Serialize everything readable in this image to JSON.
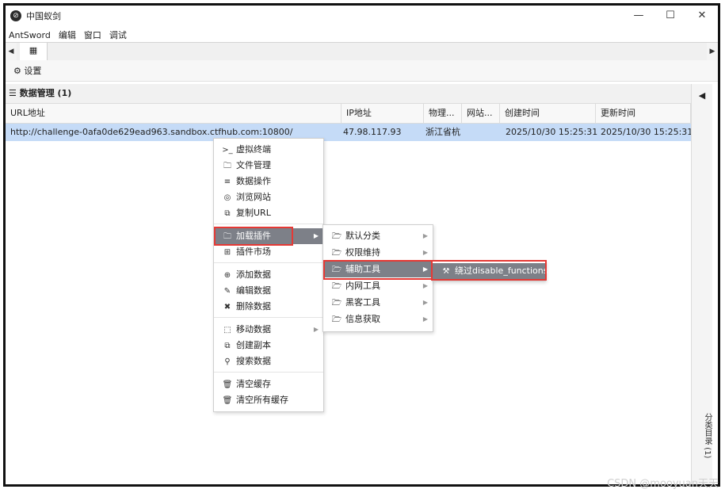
{
  "window": {
    "title": "中国蚁剑",
    "controls": [
      "—",
      "☐",
      "✕"
    ]
  },
  "menubar": [
    "AntSword",
    "编辑",
    "窗口",
    "调试"
  ],
  "toolbar": {
    "settings_label": "设置"
  },
  "panel": {
    "header": "数据管理 (1)"
  },
  "grid": {
    "columns": [
      "URL地址",
      "IP地址",
      "物理...",
      "网站...",
      "创建时间",
      "更新时间"
    ],
    "rows": [
      [
        "http://challenge-0afa0de629ead963.sandbox.ctfhub.com:10800/",
        "47.98.117.93",
        "浙江省杭",
        "",
        "2025/10/30 15:25:31",
        "2025/10/30 15:25:31"
      ]
    ]
  },
  "rail": {
    "label": "分类目录 (1)"
  },
  "context_menu": {
    "items": [
      {
        "icon": "terminal-icon",
        "glyph": ">_",
        "label": "虚拟终端"
      },
      {
        "icon": "folder-icon",
        "glyph": "🗀",
        "label": "文件管理"
      },
      {
        "icon": "database-icon",
        "glyph": "≡",
        "label": "数据操作"
      },
      {
        "icon": "chrome-icon",
        "glyph": "◎",
        "label": "浏览网站"
      },
      {
        "icon": "copy-icon",
        "glyph": "⧉",
        "label": "复制URL"
      },
      {
        "icon": "folder-icon",
        "glyph": "🗀",
        "label": "加载插件"
      },
      {
        "icon": "cart-icon",
        "glyph": "⊞",
        "label": "插件市场"
      },
      {
        "icon": "plus-circle-icon",
        "glyph": "⊕",
        "label": "添加数据"
      },
      {
        "icon": "edit-icon",
        "glyph": "✎",
        "label": "编辑数据"
      },
      {
        "icon": "delete-icon",
        "glyph": "✖",
        "label": "删除数据"
      },
      {
        "icon": "move-icon",
        "glyph": "⬚",
        "label": "移动数据"
      },
      {
        "icon": "copy-icon",
        "glyph": "⧉",
        "label": "创建副本"
      },
      {
        "icon": "search-icon",
        "glyph": "⚲",
        "label": "搜索数据"
      },
      {
        "icon": "trash-icon",
        "glyph": "🗑",
        "label": "清空缓存"
      },
      {
        "icon": "trash-icon",
        "glyph": "🗑",
        "label": "清空所有缓存"
      }
    ]
  },
  "plugin_menu": {
    "items": [
      "默认分类",
      "权限维持",
      "辅助工具",
      "内网工具",
      "黑客工具",
      "信息获取"
    ]
  },
  "tool_menu": {
    "items": [
      "绕过disable_functions"
    ]
  },
  "watermark": "CSDN @mooyuan天天",
  "colors": {
    "selected_row": "#c5dbf7",
    "hover": "#7d8088",
    "highlight_box": "#e53935"
  }
}
